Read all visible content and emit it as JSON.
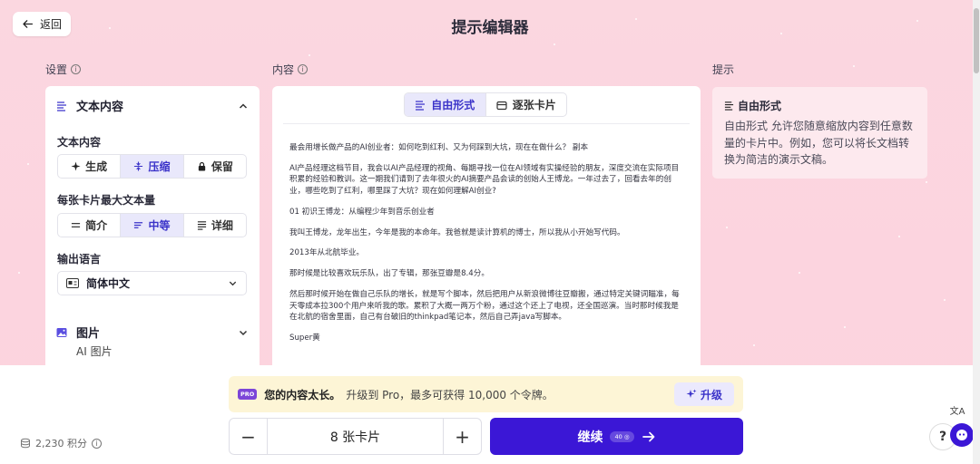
{
  "header": {
    "back_label": "返回",
    "title": "提示编辑器"
  },
  "sections": {
    "settings": "设置",
    "content": "内容",
    "hint": "提示"
  },
  "settings": {
    "card_title": "文本内容",
    "text_content_label": "文本内容",
    "text_modes": [
      "生成",
      "压缩",
      "保留"
    ],
    "text_mode_active": "压缩",
    "max_text_label": "每张卡片最大文本量",
    "text_amounts": [
      "简介",
      "中等",
      "详细"
    ],
    "text_amount_active": "中等",
    "language_label": "输出语言",
    "language_value": "简体中文",
    "images_title": "图片",
    "images_desc": "AI 图片"
  },
  "content": {
    "tabs": [
      "自由形式",
      "逐张卡片"
    ],
    "active_tab": "自由形式",
    "paragraphs": [
      "最会用增长做产品的AI创业者：如何吃到红利、又为何踩到大坑，现在在做什么？ 副本",
      "AI产品经理这档节目，我会以AI产品经理的视角、每期寻找一位在AI领域有实操经验的朋友，深度交流在实际项目积累的经验和教训。这一期我们请到了去年很火的AI摘要产品会读的创始人王博龙。一年过去了，回看去年的创业，哪些吃到了红利，哪里踩了大坑？现在如何理解AI创业?",
      "01 初识王博龙：从编程少年到音乐创业者",
      "我叫王博龙，龙年出生，今年是我的本命年。我爸就是读计算机的博士，所以我从小开始写代码。",
      "2013年从北航毕业。",
      "那时候是比较喜欢玩乐队，出了专辑，那张豆瓣是8.4分。",
      "然后那时候开始在做自己乐队的增长，就是写个脚本，然后把用户从新浪微博往豆瓣搬，通过特定关键词瞄准，每天零成本拉300个用户来听我的歌。累积了大概一两万个粉，通过这个还上了电视，还全国巡演。当时那时候我是在北航的宿舍里面，自己有台破旧的thinkpad笔记本，然后自己弄java写脚本。",
      "Super黄"
    ]
  },
  "hint": {
    "title": "自由形式",
    "body": "自由形式 允许您随意缩放内容到任意数量的卡片中。例如，您可以将长文档转换为简洁的演示文稿。"
  },
  "bottom": {
    "pro_badge": "PRO",
    "warning_strong": "您的内容太长。",
    "warning_rest": "升级到 Pro，最多可获得 10,000 个令牌。",
    "upgrade_label": "升级",
    "card_count": "8 张卡片",
    "decrement": "−",
    "increment": "+",
    "continue_label": "继续",
    "continue_cost": "40",
    "credits": "2,230 积分"
  },
  "colors": {
    "accent": "#3b17d6",
    "accent_soft": "#e9e8fb",
    "background": "#fbd7e0",
    "warning_bg": "#fdf5d6"
  }
}
